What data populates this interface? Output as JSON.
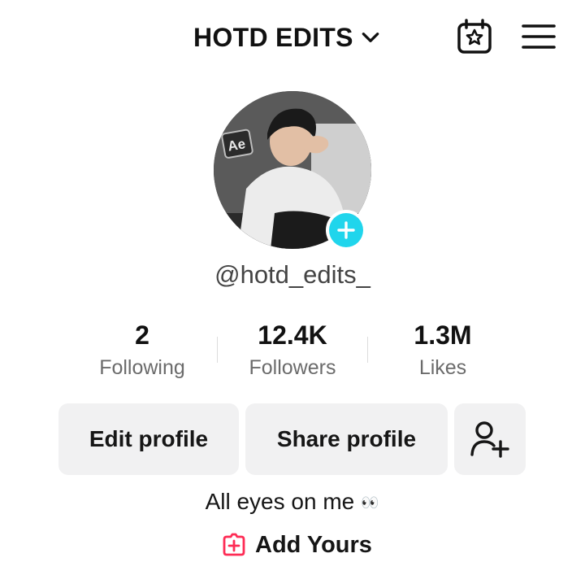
{
  "header": {
    "account_name": "HOTD EDITS",
    "icons": [
      "chevron-down-icon",
      "calendar-star-icon",
      "hamburger-menu-icon"
    ]
  },
  "profile": {
    "avatar_text": "Ae",
    "username": "@hotd_edits_",
    "accent_color": "#20d5ec"
  },
  "stats": [
    {
      "value": "2",
      "label": "Following"
    },
    {
      "value": "12.4K",
      "label": "Followers"
    },
    {
      "value": "1.3M",
      "label": "Likes"
    }
  ],
  "actions": {
    "edit_profile": "Edit profile",
    "share_profile": "Share profile",
    "add_friend_icon": "add-person-icon"
  },
  "bio": {
    "text": "All eyes on me",
    "emoji": "👀"
  },
  "add_yours": {
    "label": "Add Yours",
    "icon": "add-yours-icon",
    "icon_color": "#fe2c55"
  }
}
